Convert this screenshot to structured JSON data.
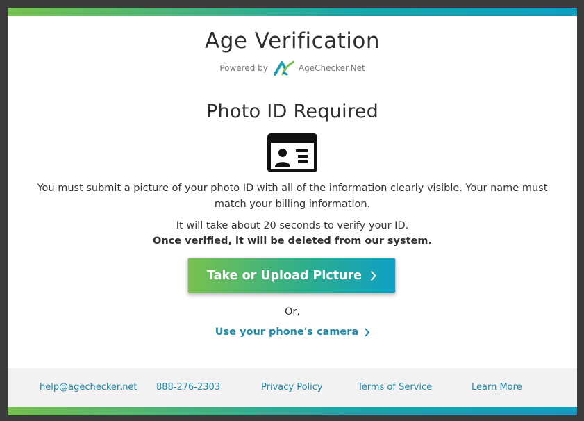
{
  "header": {
    "title": "Age Verification",
    "powered_by": "Powered by",
    "brand": "AgeChecker.Net"
  },
  "main": {
    "subtitle": "Photo ID Required",
    "description": "You must submit a picture of your photo ID with all of the information clearly visible. Your name must match your billing information.",
    "time_note": "It will take about 20 seconds to verify your ID.",
    "deletion_note": "Once verified, it will be deleted from our system.",
    "upload_button": "Take or Upload Picture",
    "or_text": "Or,",
    "camera_link": "Use your phone's camera"
  },
  "footer": {
    "email": "help@agechecker.net",
    "phone": "888-276-2303",
    "privacy": "Privacy Policy",
    "terms": "Terms of Service",
    "learn_more": "Learn More"
  },
  "colors": {
    "gradient_start": "#76c04e",
    "gradient_end": "#0f9ec2",
    "link": "#1f8aa8",
    "backdrop": "#3b3b3b"
  },
  "icons": [
    "agechecker-logo-icon",
    "photo-id-card-icon",
    "chevron-right-icon"
  ]
}
